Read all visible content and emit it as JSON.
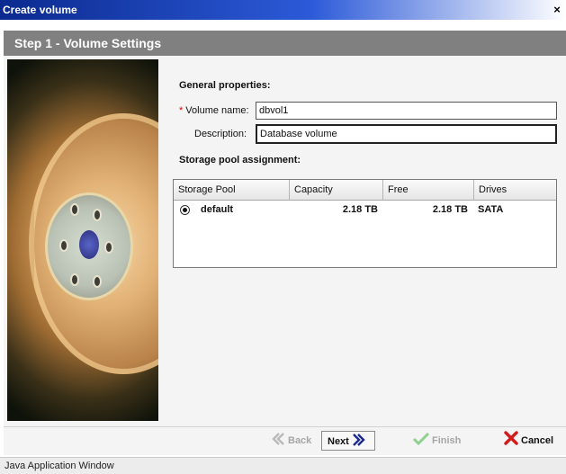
{
  "window": {
    "title": "Create volume",
    "close_glyph": "×"
  },
  "step": {
    "title": "Step 1 - Volume Settings"
  },
  "general": {
    "heading": "General properties:",
    "volume_name": {
      "required_mark": "*",
      "label": "Volume name:",
      "value": "dbvol1"
    },
    "description": {
      "label": "Description:",
      "value": "Database volume"
    }
  },
  "pool": {
    "heading": "Storage pool assignment:",
    "columns": [
      "Storage Pool",
      "Capacity",
      "Free",
      "Drives"
    ],
    "rows": [
      {
        "selected": true,
        "name": "default",
        "capacity": "2.18 TB",
        "free": "2.18 TB",
        "drives": "SATA"
      }
    ]
  },
  "buttons": {
    "back": {
      "label": "Back",
      "enabled": false,
      "icon": "back-arrow-icon"
    },
    "next": {
      "label": "Next",
      "enabled": true,
      "icon": "next-arrow-icon"
    },
    "finish": {
      "label": "Finish",
      "enabled": false,
      "icon": "checkmark-icon"
    },
    "cancel": {
      "label": "Cancel",
      "enabled": true,
      "icon": "red-x-icon"
    }
  },
  "status": {
    "text": "Java Application Window"
  },
  "colors": {
    "titlebar": "#0b2a8f",
    "stepbar": "#808080",
    "next_arrow": "#1b2a8c",
    "cancel_x": "#d11a1a",
    "finish_check": "#7fc77f"
  }
}
